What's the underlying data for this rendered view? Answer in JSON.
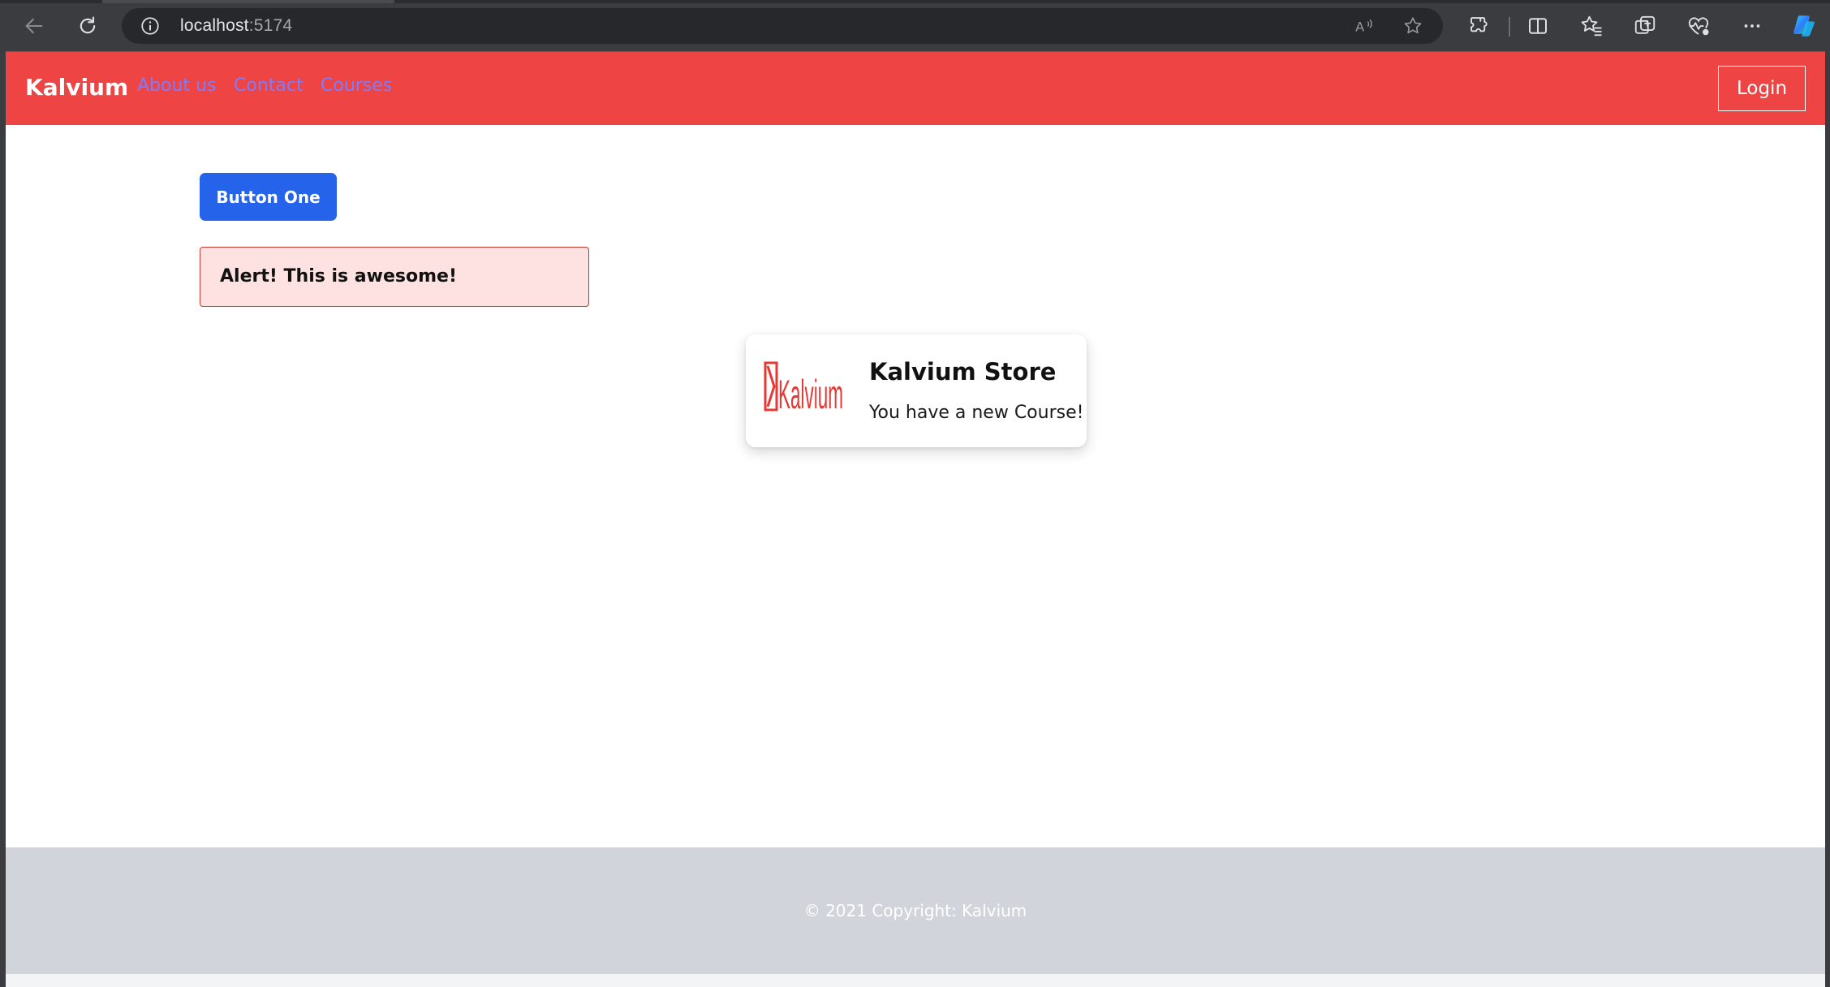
{
  "browser": {
    "url_host": "localhost",
    "url_port": ":5174",
    "icons": {
      "back": "back-arrow-icon",
      "refresh": "refresh-icon",
      "site_info": "info-icon",
      "read_aloud": "read-aloud-icon",
      "favorite": "star-icon",
      "extensions": "extensions-icon",
      "split_screen": "split-screen-icon",
      "favorites": "favorites-icon",
      "collections": "collections-icon",
      "performance": "heart-pulse-icon",
      "more": "more-icon",
      "copilot": "copilot-icon"
    }
  },
  "navbar": {
    "brand": "Kalvium",
    "links": [
      "About us",
      "Contact",
      "Courses"
    ],
    "login_label": "Login",
    "background": "#ef4444",
    "link_color": "#7c7cff"
  },
  "main": {
    "button_one_label": "Button One",
    "button_color": "#2563eb",
    "alert_text": "Alert! This is awesome!",
    "alert_background": "#fee2e2"
  },
  "card": {
    "logo_text": "Kalvium",
    "title": "Kalvium Store",
    "text": "You have a new Course!"
  },
  "footer": {
    "copyright": "© 2021 Copyright: Kalvium",
    "background": "#d1d5db"
  }
}
